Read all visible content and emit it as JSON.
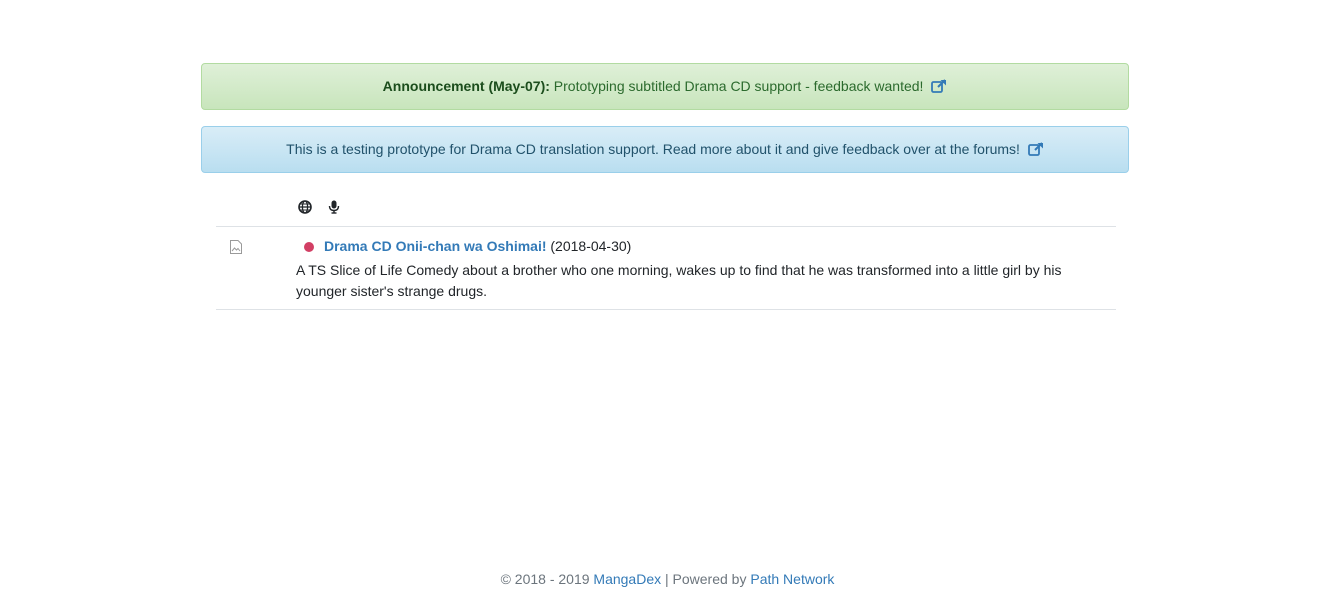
{
  "announcement": {
    "label": "Announcement (May-07):",
    "message": "Prototyping subtitled Drama CD support - feedback wanted!"
  },
  "info_banner": {
    "message": "This is a testing prototype for Drama CD translation support. Read more about it and give feedback over at the forums!"
  },
  "list_header": {
    "icons": [
      "globe-icon",
      "microphone-icon"
    ]
  },
  "entries": [
    {
      "title": "Drama CD Onii-chan wa Oshimai!",
      "date": "(2018-04-30)",
      "description": "A TS Slice of Life Comedy about a brother who one morning, wakes up to find that he was transformed into a little girl by his younger sister's strange drugs.",
      "status_color": "#d23f64"
    }
  ],
  "footer": {
    "copyright": "© 2018 - 2019",
    "site_link": "MangaDex",
    "separator": "| Powered by",
    "network_link": "Path Network"
  },
  "colors": {
    "link": "#337ab7",
    "success_bg": "#dff0d8",
    "info_bg": "#d9edf7"
  }
}
